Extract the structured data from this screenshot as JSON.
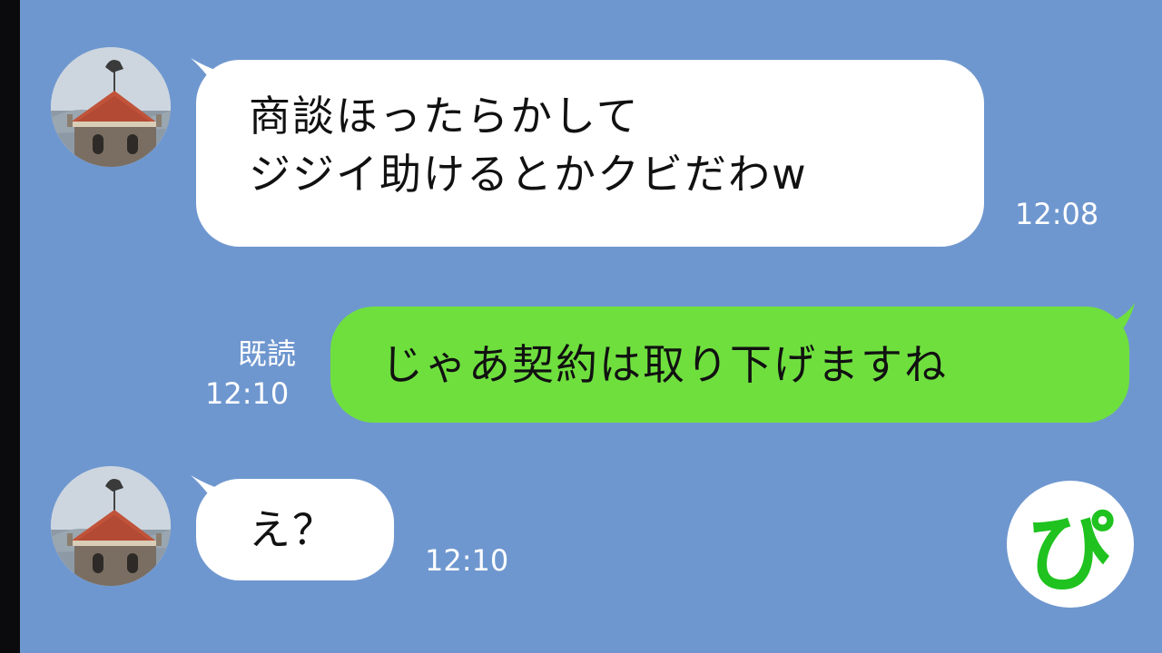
{
  "chat": {
    "background_color": "#6f97cf",
    "incoming_bubble_color": "#ffffff",
    "outgoing_bubble_color": "#6fdf3e",
    "messages": [
      {
        "direction": "incoming",
        "lines": [
          "商談ほったらかして",
          "ジジイ助けるとかクビだわw"
        ],
        "time": "12:08"
      },
      {
        "direction": "outgoing",
        "lines": [
          "じゃあ契約は取り下げますね"
        ],
        "read_label": "既読",
        "time": "12:10"
      },
      {
        "direction": "incoming",
        "lines": [
          "え？"
        ],
        "time": "12:10"
      }
    ]
  },
  "contact": {
    "avatar_icon": "tower-weathervane-avatar"
  },
  "watermark": {
    "glyph": "ぴ",
    "color": "#1fc21f",
    "icon": "pi-logo-icon"
  }
}
